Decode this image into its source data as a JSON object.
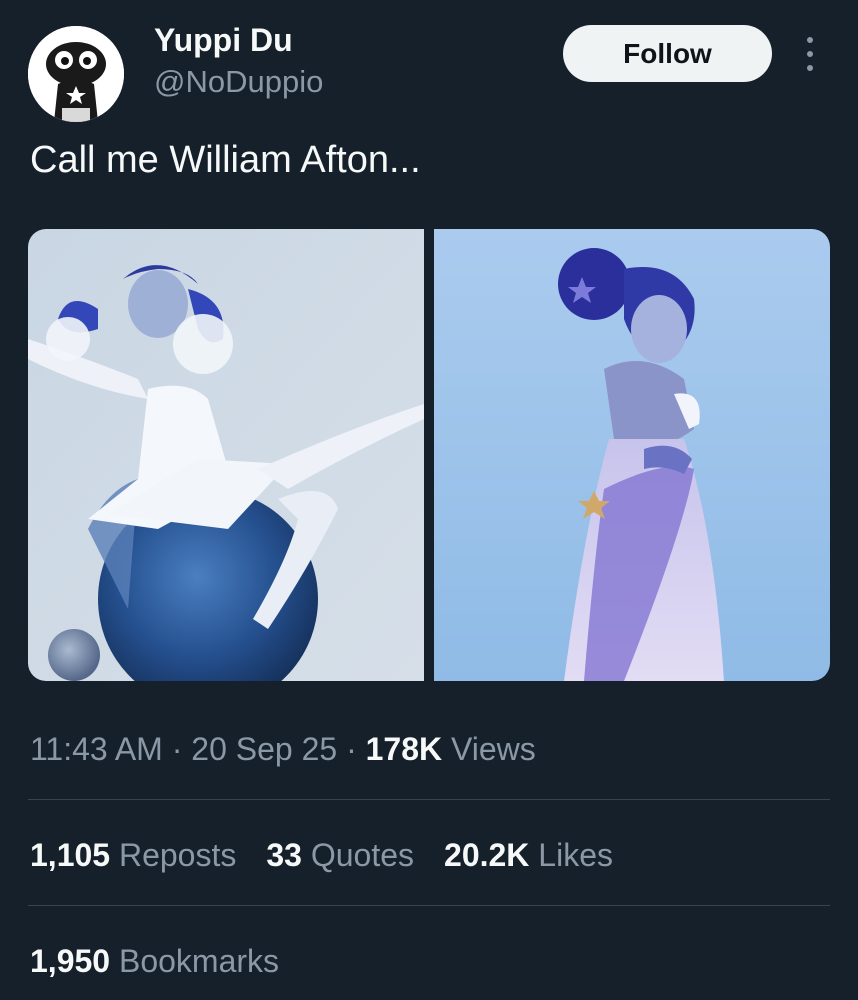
{
  "author": {
    "display_name": "Yuppi Du",
    "handle": "@NoDuppio"
  },
  "follow_label": "Follow",
  "tweet_text": "Call me William Afton...",
  "media": [
    {
      "alt": "",
      "icon": "image-1"
    },
    {
      "alt": "",
      "icon": "image-2"
    }
  ],
  "meta": {
    "time": "11:43 AM",
    "sep1": " · ",
    "date": "20 Sep 25",
    "sep2": " · ",
    "views_count": "178K",
    "views_label": " Views"
  },
  "stats": {
    "reposts_count": "1,105",
    "reposts_label": " Reposts",
    "quotes_count": "33",
    "quotes_label": " Quotes",
    "likes_count": "20.2K",
    "likes_label": " Likes",
    "bookmarks_count": "1,950",
    "bookmarks_label": " Bookmarks"
  },
  "colors": {
    "background": "#15202b",
    "text_primary": "#f7f9f9",
    "text_secondary": "#8b98a5",
    "divider": "#38444d",
    "follow_bg": "#eff3f4"
  }
}
